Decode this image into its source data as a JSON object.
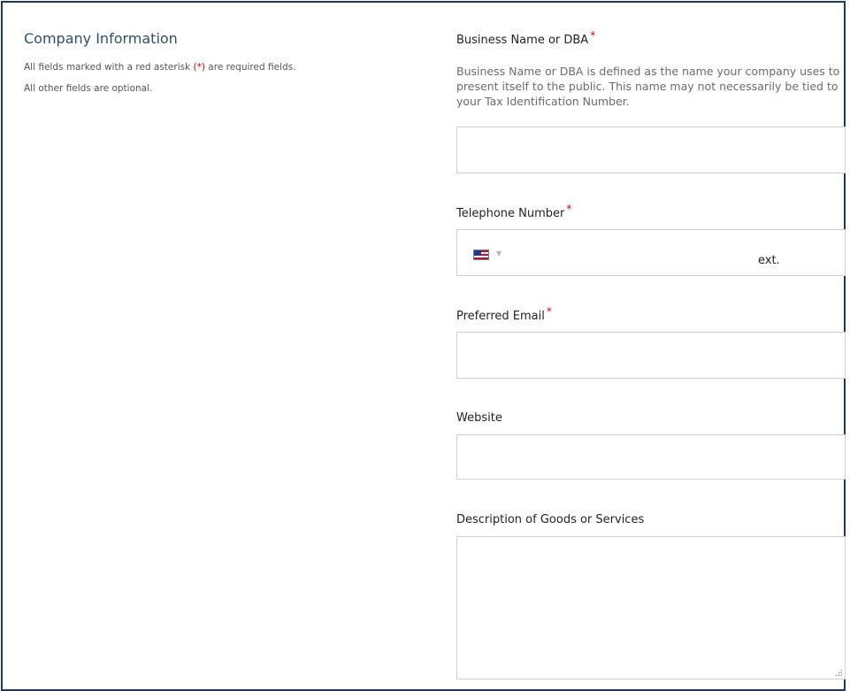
{
  "section": {
    "title": "Company Information",
    "note_required_prefix": "All fields marked with a red asterisk ",
    "note_required_asterisk": "(*)",
    "note_required_suffix": " are required fields.",
    "note_optional": "All other fields are optional."
  },
  "fields": {
    "business_name": {
      "label": "Business Name or DBA",
      "required_mark": "*",
      "help": "Business Name or DBA is defined as the name your company uses to present itself to the public. This name may not necessarily be tied to your Tax Identification Number.",
      "value": ""
    },
    "telephone": {
      "label": "Telephone Number",
      "required_mark": "*",
      "country_icon": "us-flag-icon",
      "value": "",
      "ext_label": "ext.",
      "ext_value": ""
    },
    "email": {
      "label": "Preferred Email",
      "required_mark": "*",
      "value": ""
    },
    "website": {
      "label": "Website",
      "value": ""
    },
    "description": {
      "label": "Description of Goods or Services",
      "value": ""
    }
  },
  "colors": {
    "frame_border": "#1f3864",
    "section_title": "#2f4f6a",
    "required_asterisk": "#d40000",
    "input_border": "#cfcfcf",
    "help_text": "#6b6b6b"
  }
}
